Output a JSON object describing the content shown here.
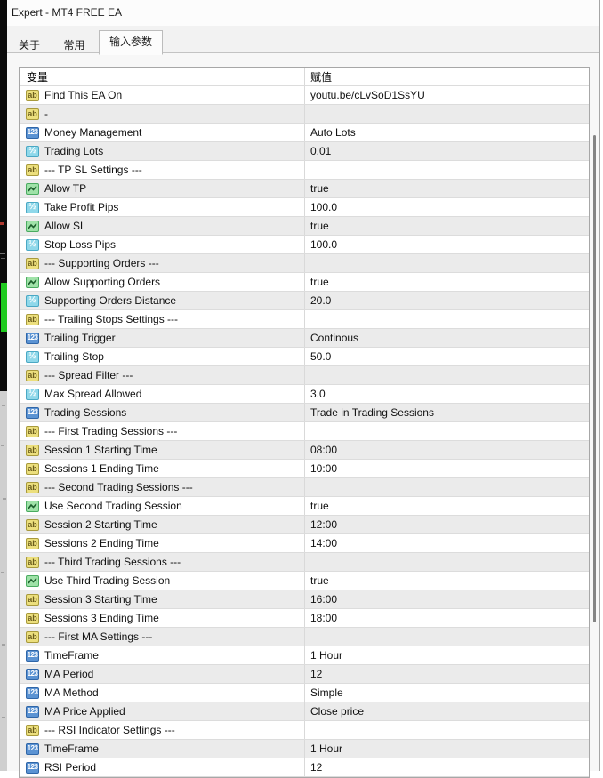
{
  "window": {
    "title": "Expert - MT4 FREE EA"
  },
  "tabs": [
    {
      "label": "关于",
      "active": false
    },
    {
      "label": "常用",
      "active": false
    },
    {
      "label": "输入参数",
      "active": true
    }
  ],
  "icons": {
    "string": "ab",
    "int": "123",
    "double": "½",
    "bool": "zigzag"
  },
  "colors": {
    "row_alt": "#ebebeb",
    "grid_line": "#dcdcdc",
    "icon_string_bg": "#ecdf7d",
    "icon_int_bg": "#5b93d3",
    "icon_double_bg": "#8fd8ea",
    "icon_bool_bg": "#9fe2a8",
    "backdrop_candle_green": "#1fcb1f"
  },
  "table": {
    "headers": {
      "variable": "变量",
      "value": "赋值"
    },
    "rows": [
      {
        "icon": "string",
        "name": "Find This EA On",
        "value": "youtu.be/cLvSoD1SsYU"
      },
      {
        "icon": "string",
        "name": "-",
        "value": ""
      },
      {
        "icon": "int",
        "name": "Money Management",
        "value": "Auto Lots"
      },
      {
        "icon": "double",
        "name": "Trading Lots",
        "value": "0.01"
      },
      {
        "icon": "string",
        "name": "--- TP SL Settings ---",
        "value": ""
      },
      {
        "icon": "bool",
        "name": "Allow TP",
        "value": "true"
      },
      {
        "icon": "double",
        "name": "Take Profit Pips",
        "value": "100.0"
      },
      {
        "icon": "bool",
        "name": "Allow SL",
        "value": "true"
      },
      {
        "icon": "double",
        "name": "Stop Loss Pips",
        "value": "100.0"
      },
      {
        "icon": "string",
        "name": "--- Supporting Orders ---",
        "value": ""
      },
      {
        "icon": "bool",
        "name": "Allow Supporting Orders",
        "value": "true"
      },
      {
        "icon": "double",
        "name": "Supporting Orders Distance",
        "value": "20.0"
      },
      {
        "icon": "string",
        "name": "--- Trailing Stops Settings ---",
        "value": ""
      },
      {
        "icon": "int",
        "name": "Trailing Trigger",
        "value": "Continous"
      },
      {
        "icon": "double",
        "name": "Trailing Stop",
        "value": "50.0"
      },
      {
        "icon": "string",
        "name": "--- Spread Filter ---",
        "value": ""
      },
      {
        "icon": "double",
        "name": "Max Spread Allowed",
        "value": "3.0"
      },
      {
        "icon": "int",
        "name": "Trading Sessions",
        "value": "Trade in Trading Sessions"
      },
      {
        "icon": "string",
        "name": "--- First Trading Sessions ---",
        "value": ""
      },
      {
        "icon": "string",
        "name": "Session 1 Starting Time",
        "value": "08:00"
      },
      {
        "icon": "string",
        "name": "Sessions 1 Ending Time",
        "value": "10:00"
      },
      {
        "icon": "string",
        "name": "--- Second Trading Sessions ---",
        "value": ""
      },
      {
        "icon": "bool",
        "name": "Use Second Trading Session",
        "value": "true"
      },
      {
        "icon": "string",
        "name": "Session 2 Starting Time",
        "value": "12:00"
      },
      {
        "icon": "string",
        "name": "Sessions 2 Ending Time",
        "value": "14:00"
      },
      {
        "icon": "string",
        "name": "--- Third Trading Sessions ---",
        "value": ""
      },
      {
        "icon": "bool",
        "name": "Use Third Trading Session",
        "value": "true"
      },
      {
        "icon": "string",
        "name": "Session 3 Starting Time",
        "value": "16:00"
      },
      {
        "icon": "string",
        "name": "Sessions 3 Ending Time",
        "value": "18:00"
      },
      {
        "icon": "string",
        "name": "--- First MA Settings ---",
        "value": ""
      },
      {
        "icon": "int",
        "name": "TimeFrame",
        "value": "1 Hour"
      },
      {
        "icon": "int",
        "name": "MA Period",
        "value": "12"
      },
      {
        "icon": "int",
        "name": "MA Method",
        "value": "Simple"
      },
      {
        "icon": "int",
        "name": "MA Price Applied",
        "value": "Close price"
      },
      {
        "icon": "string",
        "name": "--- RSI Indicator Settings ---",
        "value": ""
      },
      {
        "icon": "int",
        "name": "TimeFrame",
        "value": "1 Hour"
      },
      {
        "icon": "int",
        "name": "RSI Period",
        "value": "12"
      }
    ]
  }
}
